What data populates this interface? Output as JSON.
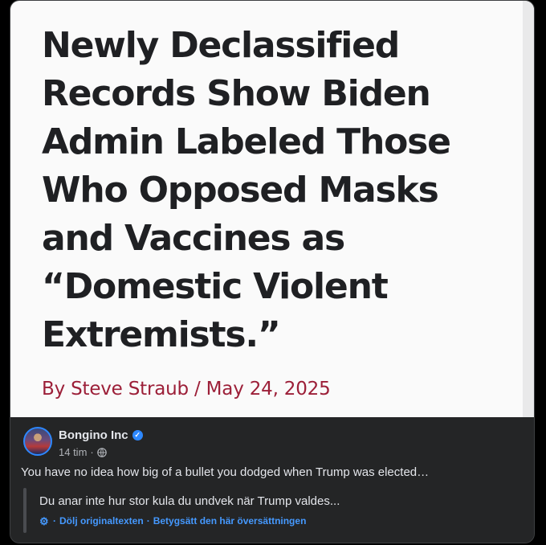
{
  "article_image": {
    "headline": "Newly Declassified Records Show Biden Admin Labeled Those Who Opposed Masks and Vaccines as “Domestic Violent Extremists.”",
    "byline": "By Steve Straub / May 24, 2025",
    "byline_color": "#9c1f38"
  },
  "post": {
    "author": "Bongino Inc",
    "verified_icon": "verified-badge-icon",
    "time": "14 tim",
    "separator": "·",
    "audience_icon": "globe-icon",
    "text": "You have no idea how big of a bullet you dodged when Trump was elected…",
    "translation": {
      "text": "Du anar inte hur stor kula du undvek när Trump valdes...",
      "settings_icon": "gear-icon",
      "hide_original_label": "Dölj originaltexten",
      "rate_translation_label": "Betygsätt den här översättningen",
      "separator": "·"
    }
  },
  "colors": {
    "background": "#000000",
    "card": "#242526",
    "link": "#4599ff",
    "accent": "#2d88ff"
  }
}
